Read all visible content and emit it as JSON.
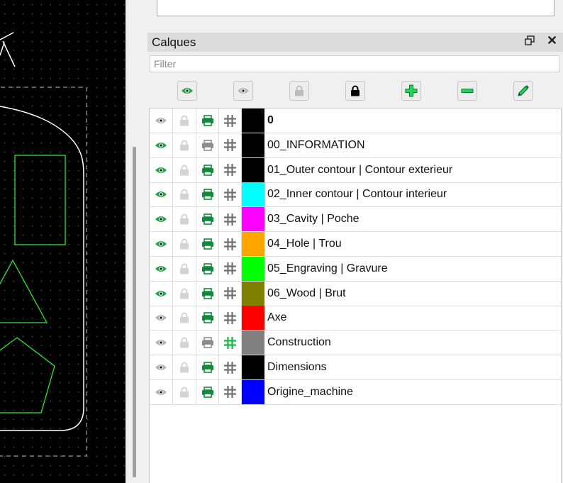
{
  "panel": {
    "title": "Calques",
    "float_icon": "float-window-icon",
    "close_glyph": "✕",
    "filter_placeholder": "Filter"
  },
  "toolbar": [
    {
      "name": "show-all-layers-button",
      "icon": "eye-icon"
    },
    {
      "name": "hide-all-layers-button",
      "icon": "eye-icon"
    },
    {
      "name": "unlock-all-layers-button",
      "icon": "unlock-icon"
    },
    {
      "name": "lock-all-layers-button",
      "icon": "lock-icon"
    },
    {
      "name": "add-layer-button",
      "icon": "plus-icon"
    },
    {
      "name": "remove-layer-button",
      "icon": "minus-icon"
    },
    {
      "name": "edit-layer-button",
      "icon": "pencil-icon"
    }
  ],
  "colors": {
    "accent_green": "#1ea84a",
    "inactive_gray": "#b5b5b5"
  },
  "layers": [
    {
      "name": "0",
      "visible": false,
      "print": true,
      "construction": false,
      "color": "#000000",
      "bold": true
    },
    {
      "name": "00_INFORMATION",
      "visible": true,
      "print": false,
      "construction": false,
      "color": "#000000",
      "bold": false
    },
    {
      "name": "01_Outer contour | Contour exterieur",
      "visible": true,
      "print": true,
      "construction": false,
      "color": "#000000",
      "bold": false
    },
    {
      "name": "02_Inner contour | Contour interieur",
      "visible": true,
      "print": true,
      "construction": false,
      "color": "#00ffff",
      "bold": false
    },
    {
      "name": "03_Cavity | Poche",
      "visible": true,
      "print": true,
      "construction": false,
      "color": "#ff00ff",
      "bold": false
    },
    {
      "name": "04_Hole | Trou",
      "visible": true,
      "print": true,
      "construction": false,
      "color": "#ffa500",
      "bold": false
    },
    {
      "name": "05_Engraving | Gravure",
      "visible": true,
      "print": true,
      "construction": false,
      "color": "#00ff00",
      "bold": false
    },
    {
      "name": "06_Wood | Brut",
      "visible": true,
      "print": true,
      "construction": false,
      "color": "#808000",
      "bold": false
    },
    {
      "name": "Axe",
      "visible": false,
      "print": true,
      "construction": false,
      "color": "#ff0000",
      "bold": false
    },
    {
      "name": "Construction",
      "visible": false,
      "print": false,
      "construction": true,
      "color": "#808080",
      "bold": false
    },
    {
      "name": "Dimensions",
      "visible": false,
      "print": true,
      "construction": false,
      "color": "#000000",
      "bold": false
    },
    {
      "name": "Origine_machine",
      "visible": false,
      "print": true,
      "construction": false,
      "color": "#0000ff",
      "bold": false
    }
  ]
}
